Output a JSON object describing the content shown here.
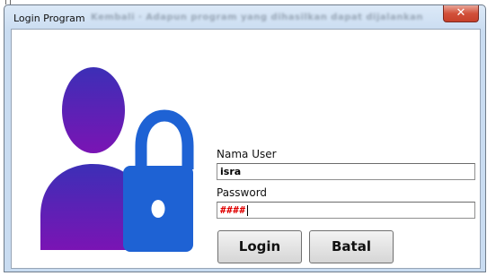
{
  "window": {
    "title": "Login Program",
    "blurred_title_text": "Kembali · Adapun program yang dihasilkan dapat dijalankan",
    "close_glyph": "✕"
  },
  "form": {
    "username_label": "Nama User",
    "username_value": "isra",
    "password_label": "Password",
    "password_value": "####"
  },
  "buttons": {
    "login_label": "Login",
    "cancel_label": "Batal"
  },
  "icons": {
    "illustration": "user-lock-icon"
  },
  "colors": {
    "user_gradient_top": "#3c2fb6",
    "user_gradient_bottom": "#7a14b4",
    "lock_blue": "#1e62d4",
    "password_text": "#e00000"
  }
}
